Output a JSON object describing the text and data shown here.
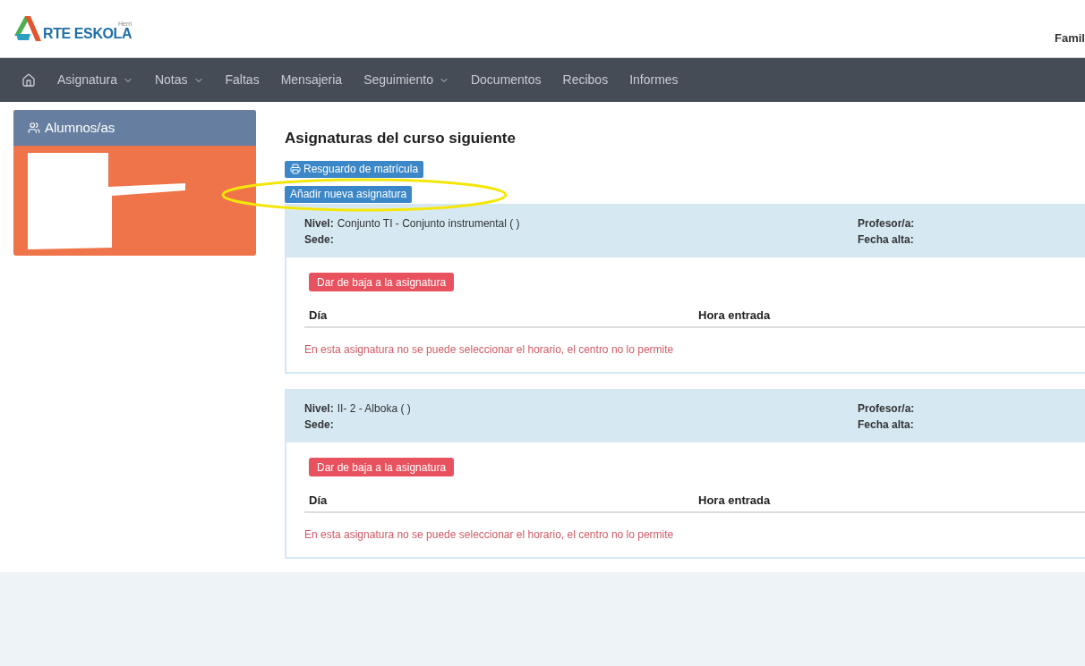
{
  "header": {
    "logo_small": "Herri",
    "logo_text": "RTE ESKOLA",
    "user": "Famil"
  },
  "nav": [
    {
      "label": "Asignatura",
      "dropdown": true
    },
    {
      "label": "Notas",
      "dropdown": true
    },
    {
      "label": "Faltas",
      "dropdown": false
    },
    {
      "label": "Mensajeria",
      "dropdown": false
    },
    {
      "label": "Seguimiento",
      "dropdown": true
    },
    {
      "label": "Documentos",
      "dropdown": false
    },
    {
      "label": "Recibos",
      "dropdown": false
    },
    {
      "label": "Informes",
      "dropdown": false
    }
  ],
  "sidebar": {
    "title": "Alumnos/as"
  },
  "main": {
    "title": "Asignaturas del curso siguiente",
    "buttons": [
      {
        "label": "Resguardo de matrícula",
        "kind": "print",
        "highlighted": false
      },
      {
        "label": "Añadir nueva asignatura",
        "kind": "plain",
        "highlighted": true
      }
    ],
    "subjects": [
      {
        "nivel_label": "Nivel:",
        "nivel": "Conjunto TI - Conjunto instrumental ( )",
        "sede_label": "Sede:",
        "profesor_label": "Profesor/a:",
        "fecha_label": "Fecha alta:",
        "drop_button": "Dar de baja a la asignatura",
        "columns": [
          "Día",
          "Hora entrada"
        ],
        "message": "En esta asignatura no se puede seleccionar el horario, el centro no lo permite"
      },
      {
        "nivel_label": "Nivel:",
        "nivel": "II- 2 - Alboka ( )",
        "sede_label": "Sede:",
        "profesor_label": "Profesor/a:",
        "fecha_label": "Fecha alta:",
        "drop_button": "Dar de baja a la asignatura",
        "columns": [
          "Día",
          "Hora entrada"
        ],
        "message": "En esta asignatura no se puede seleccionar el horario, el centro no lo permite"
      }
    ]
  }
}
